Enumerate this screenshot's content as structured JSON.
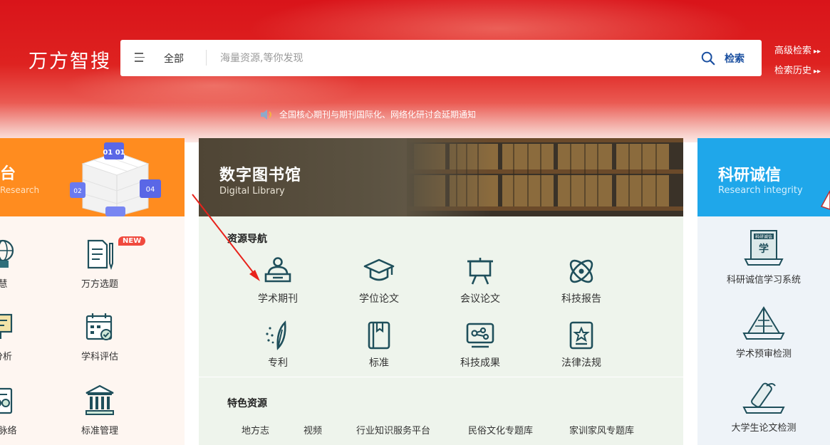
{
  "header": {
    "logo": "万方智搜",
    "search": {
      "scope": "全部",
      "placeholder": "海量资源,等你发现",
      "button_label": "检索"
    },
    "links": [
      "高级检索",
      "检索历史"
    ],
    "notice": "全国核心期刊与期刊国际化、网络化研讨会延期通知"
  },
  "left_panel": {
    "title": "台",
    "subtitle": "Research",
    "tools": [
      {
        "label": "慧",
        "icon": "globe-icon"
      },
      {
        "label": "万方选题",
        "icon": "document-pen-icon",
        "badge": "NEW"
      },
      {
        "label": "分析",
        "icon": "presentation-board-icon"
      },
      {
        "label": "学科评估",
        "icon": "calendar-check-icon"
      },
      {
        "label": "识脉络",
        "icon": "network-icon"
      },
      {
        "label": "标准管理",
        "icon": "building-icon"
      }
    ]
  },
  "center_panel": {
    "title": "数字图书馆",
    "subtitle": "Digital Library",
    "resource_nav_title": "资源导航",
    "resources": [
      {
        "label": "学术期刊",
        "icon": "reader-icon"
      },
      {
        "label": "学位论文",
        "icon": "graduation-cap-icon"
      },
      {
        "label": "会议论文",
        "icon": "easel-icon"
      },
      {
        "label": "科技报告",
        "icon": "atom-icon"
      },
      {
        "label": "专利",
        "icon": "magic-pen-icon"
      },
      {
        "label": "标准",
        "icon": "book-bookmark-icon"
      },
      {
        "label": "科技成果",
        "icon": "monitor-nodes-icon"
      },
      {
        "label": "法律法规",
        "icon": "star-document-icon"
      }
    ],
    "feature_title": "特色资源",
    "features": [
      "地方志",
      "视频",
      "行业知识服务平台",
      "民俗文化专题库",
      "家训家风专题库"
    ]
  },
  "right_panel": {
    "title": "科研诚信",
    "subtitle": "Research integrity",
    "items": [
      {
        "label": "科研诚信学习系统",
        "icon": "integrity-book-icon",
        "book_text": "科研诚信",
        "book_char": "学"
      },
      {
        "label": "学术预审检测",
        "icon": "open-book-icon"
      },
      {
        "label": "大学生论文检测",
        "icon": "diploma-scroll-icon"
      }
    ]
  },
  "colors": {
    "banner_red": "#d9141a",
    "left_accent": "#ff8c1f",
    "right_accent": "#1fa7ea",
    "icon_dark": "#1f4f5b",
    "search_blue": "#1a4fa0",
    "badge_red": "#f04a3e"
  }
}
